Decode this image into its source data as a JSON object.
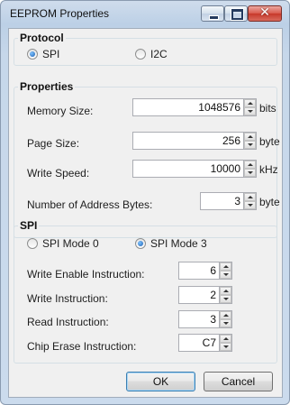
{
  "window": {
    "title": "EEPROM Properties"
  },
  "protocol": {
    "legend": "Protocol",
    "options": [
      {
        "label": "SPI",
        "selected": true
      },
      {
        "label": "I2C",
        "selected": false
      }
    ]
  },
  "properties": {
    "legend": "Properties",
    "memory_size": {
      "label": "Memory Size:",
      "value": "1048576",
      "unit": "bits"
    },
    "page_size": {
      "label": "Page Size:",
      "value": "256",
      "unit": "byte"
    },
    "write_speed": {
      "label": "Write Speed:",
      "value": "10000",
      "unit": "kHz"
    },
    "address_bytes": {
      "label": "Number of Address Bytes:",
      "value": "3",
      "unit": "byte"
    }
  },
  "spi": {
    "legend": "SPI",
    "modes": [
      {
        "label": "SPI Mode 0",
        "selected": false
      },
      {
        "label": "SPI Mode 3",
        "selected": true
      }
    ],
    "write_enable": {
      "label": "Write Enable Instruction:",
      "value": "6"
    },
    "write": {
      "label": "Write Instruction:",
      "value": "2"
    },
    "read": {
      "label": "Read Instruction:",
      "value": "3"
    },
    "chip_erase": {
      "label": "Chip Erase Instruction:",
      "value": "C7"
    }
  },
  "buttons": {
    "ok": "OK",
    "cancel": "Cancel"
  }
}
